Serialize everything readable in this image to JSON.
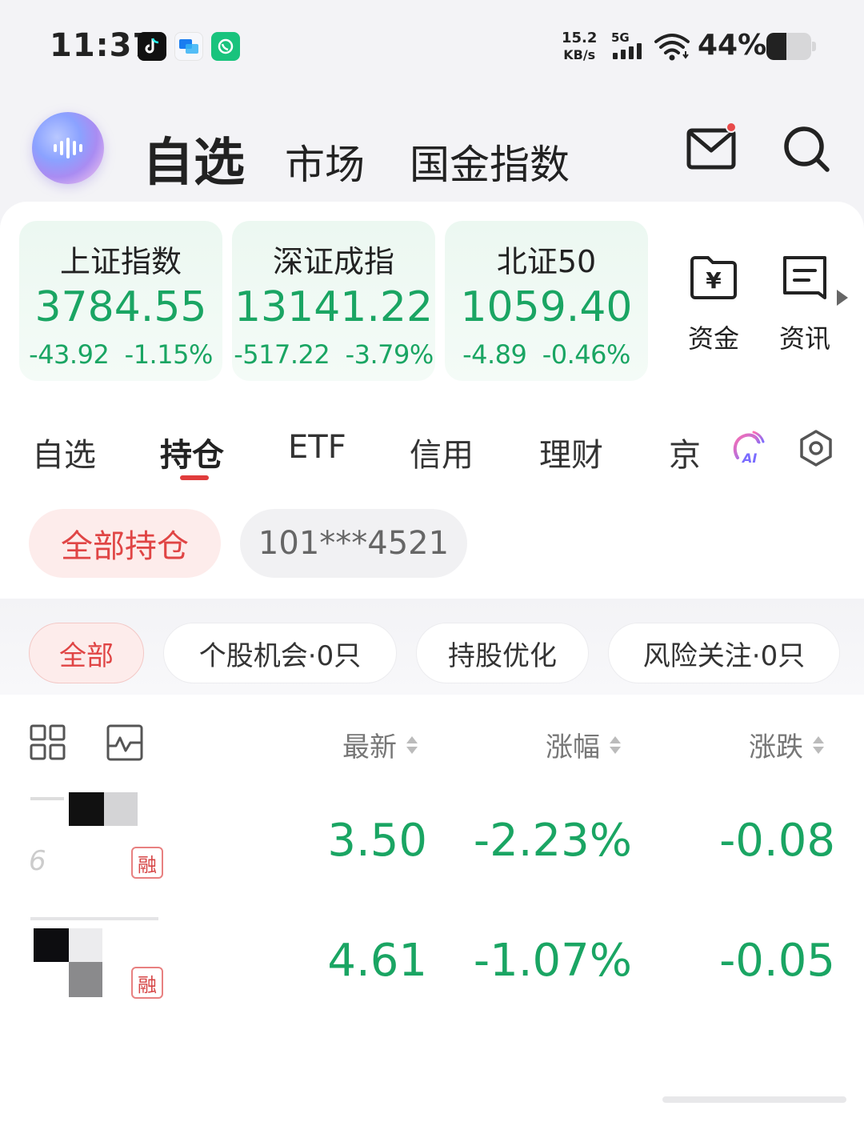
{
  "status_bar": {
    "time": "11:37",
    "app_icons": [
      "tiktok-icon",
      "messages-icon",
      "phone-call-icon"
    ],
    "net_speed_value": "15.2",
    "net_speed_unit": "KB/s",
    "network_type": "5G",
    "battery_percent": "44%",
    "battery_level": 0.44
  },
  "header": {
    "nav": [
      "自选",
      "市场",
      "国金指数"
    ],
    "active_nav": "自选",
    "mail_has_notification": true
  },
  "indices": [
    {
      "name": "上证指数",
      "value": "3784.55",
      "change": "-43.92",
      "change_pct": "-1.15%"
    },
    {
      "name": "深证成指",
      "value": "13141.22",
      "change": "-517.22",
      "change_pct": "-3.79%"
    },
    {
      "name": "北证50",
      "value": "1059.40",
      "change": "-4.89",
      "change_pct": "-0.46%"
    }
  ],
  "quick_actions": [
    {
      "label": "资金",
      "icon": "yuan-folder-icon"
    },
    {
      "label": "资讯",
      "icon": "news-doc-icon"
    }
  ],
  "tabs": [
    "自选",
    "持仓",
    "ETF",
    "信用",
    "理财",
    "京"
  ],
  "active_tab": "持仓",
  "account_pills": {
    "all_holdings": "全部持仓",
    "account": "101***4521"
  },
  "filters": [
    "全部",
    "个股机会·0只",
    "持股优化",
    "风险关注·0只"
  ],
  "active_filter": "全部",
  "columns": {
    "latest": "最新",
    "change_pct": "涨幅",
    "change": "涨跌"
  },
  "holdings": [
    {
      "latest": "3.50",
      "change_pct": "-2.23%",
      "change": "-0.08",
      "badge": "融",
      "code_partial": "6"
    },
    {
      "latest": "4.61",
      "change_pct": "-1.07%",
      "change": "-0.05",
      "badge": "融"
    }
  ],
  "colors": {
    "down_green": "#1aa563",
    "accent_red": "#e04545",
    "background": "#f3f3f6"
  }
}
